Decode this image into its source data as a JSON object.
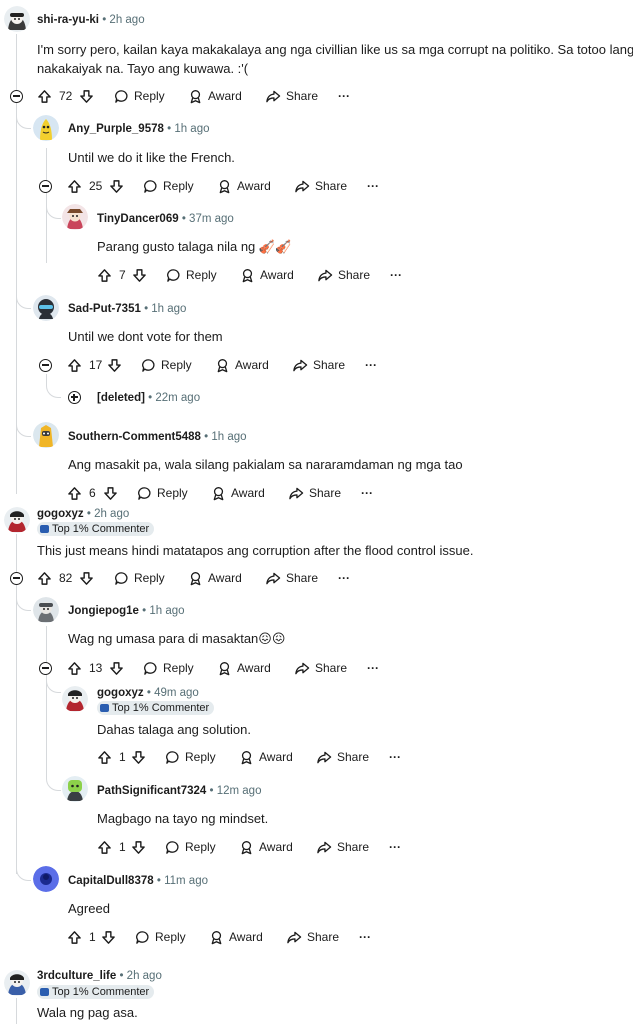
{
  "actions": {
    "reply": "Reply",
    "award": "Award",
    "share": "Share",
    "more": "···"
  },
  "comments": [
    {
      "author": "shi-ra-yu-ki",
      "time": "• 2h ago",
      "line1": "I'm sorry pero, kailan kaya makakalaya ang nga civillian like us sa mga corrupt na politiko. Sa totoo lang",
      "line2": "nakakaiyak na. Tayo ang kuwawa. :'(",
      "votes": "72"
    },
    {
      "author": "Any_Purple_9578",
      "time": "• 1h ago",
      "text": "Until we do it like the French.",
      "votes": "25"
    },
    {
      "author": "TinyDancer069",
      "time": "• 37m ago",
      "text": "Parang gusto talaga nila ng",
      "emoji": "🎻🎻",
      "votes": "7"
    },
    {
      "author": "Sad-Put-7351",
      "time": "• 1h ago",
      "text": "Until we dont vote for them",
      "votes": "17"
    },
    {
      "author": "[deleted]",
      "time": "• 22m ago"
    },
    {
      "author": "Southern-Comment5488",
      "time": "• 1h ago",
      "text": "Ang masakit pa, wala silang pakialam sa nararamdaman ng mga tao",
      "votes": "6"
    },
    {
      "author": "gogoxyz",
      "time": "• 2h ago",
      "badge": "Top 1% Commenter",
      "text": "This just means hindi matatapos ang corruption after the flood control issue.",
      "votes": "82"
    },
    {
      "author": "Jongiepog1e",
      "time": "• 1h ago",
      "text": "Wag ng umasa para di masaktan",
      "emoji": "😖😖",
      "votes": "13"
    },
    {
      "author": "gogoxyz",
      "time": "• 49m ago",
      "badge": "Top 1% Commenter",
      "text": "Dahas talaga ang solution.",
      "votes": "1"
    },
    {
      "author": "PathSignificant7324",
      "time": "• 12m ago",
      "text": "Magbago na tayo ng mindset.",
      "votes": "1"
    },
    {
      "author": "CapitalDull8378",
      "time": "• 11m ago",
      "text": "Agreed",
      "votes": "1"
    },
    {
      "author": "3rdculture_life",
      "time": "• 2h ago",
      "badge": "Top 1% Commenter",
      "text": "Wala ng pag asa."
    }
  ]
}
